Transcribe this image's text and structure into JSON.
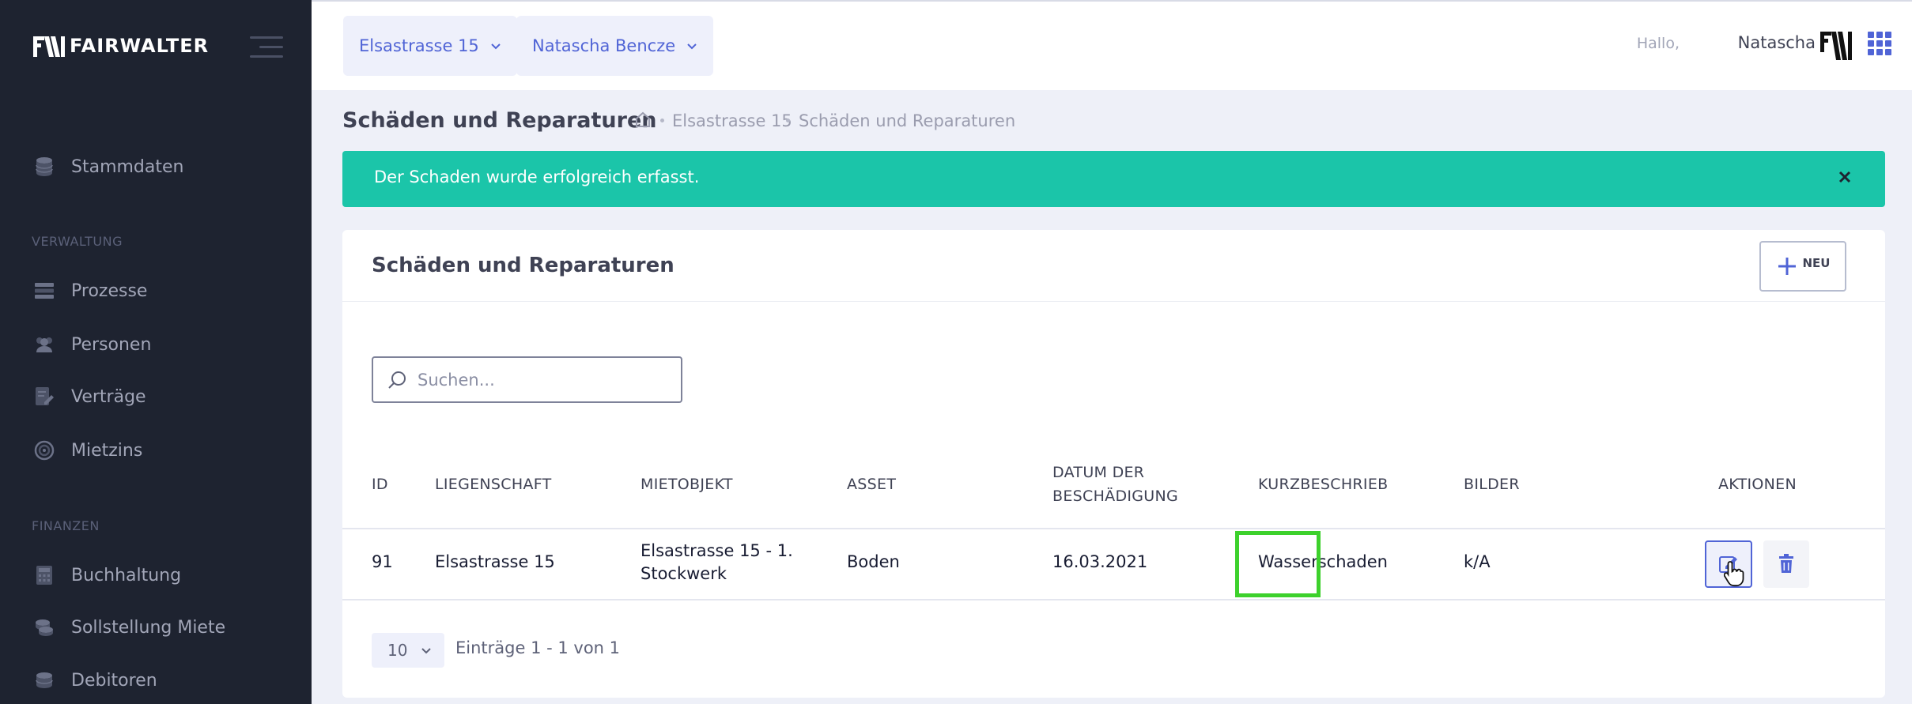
{
  "app": {
    "brand": "FAIRWALTER"
  },
  "sidebar": {
    "items": [
      {
        "label": "Stammdaten",
        "icon": "database-icon"
      },
      {
        "label": "Prozesse",
        "icon": "server-icon"
      },
      {
        "label": "Personen",
        "icon": "users-icon"
      },
      {
        "label": "Verträge",
        "icon": "contract-edit-icon"
      },
      {
        "label": "Mietzins",
        "icon": "coin-target-icon"
      },
      {
        "label": "Buchhaltung",
        "icon": "calculator-icon"
      },
      {
        "label": "Sollstellung Miete",
        "icon": "coins-icon"
      },
      {
        "label": "Debitoren",
        "icon": "coins-stack-icon"
      }
    ],
    "sections": {
      "verwaltung": "VERWALTUNG",
      "finanzen": "FINANZEN"
    }
  },
  "topbar": {
    "property_selector": "Elsastrasse 15",
    "person_selector": "Natascha Bencze",
    "greeting": "Hallo,",
    "user_name": "Natascha"
  },
  "subheader": {
    "title": "Schäden und Reparaturen",
    "breadcrumb": [
      "Elsastrasse 15",
      "Schäden und Reparaturen"
    ]
  },
  "alert": {
    "message": "Der Schaden wurde erfolgreich erfasst."
  },
  "card": {
    "title": "Schäden und Reparaturen",
    "new_button": "NEU",
    "search_placeholder": "Suchen...",
    "columns": {
      "id": "ID",
      "liegenschaft": "LIEGENSCHAFT",
      "mietobjekt": "MIETOBJEKT",
      "asset": "ASSET",
      "datum_line1": "DATUM DER",
      "datum_line2": "BESCHÄDIGUNG",
      "kurzbeschrieb": "KURZBESCHRIEB",
      "bilder": "BILDER",
      "aktionen": "AKTIONEN"
    },
    "rows": [
      {
        "id": "91",
        "liegenschaft": "Elsastrasse 15",
        "mietobjekt_line1": "Elsastrasse 15 - 1.",
        "mietobjekt_line2": "Stockwerk",
        "asset": "Boden",
        "datum": "16.03.2021",
        "kurzbeschrieb": "Wasserschaden",
        "bilder": "k/A"
      }
    ],
    "page_size": "10",
    "entries_info": "Einträge 1 - 1 von 1"
  },
  "colors": {
    "sidebar_bg": "#1e2330",
    "accent": "#5064d6",
    "success": "#1bc5a9",
    "highlight": "#3dd12c"
  }
}
